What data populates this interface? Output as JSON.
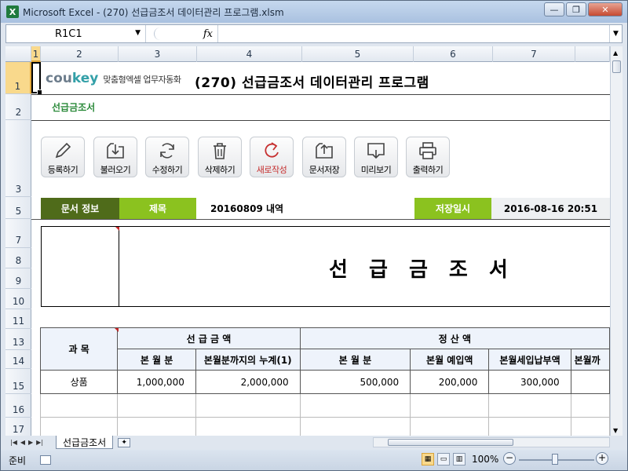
{
  "window": {
    "title": "Microsoft Excel - (270) 선급금조서 데이터관리 프로그램.xlsm",
    "app_icon": "X",
    "buttons": {
      "minimize": "—",
      "restore": "❐",
      "close": "✕"
    }
  },
  "formula_bar": {
    "name_box": "R1C1",
    "fx": "fx",
    "formula": ""
  },
  "columns": [
    "1",
    "2",
    "3",
    "4",
    "5",
    "6",
    "7"
  ],
  "rows": [
    "1",
    "2",
    "3",
    "5",
    "7",
    "8",
    "9",
    "10",
    "11",
    "13",
    "14",
    "15",
    "16",
    "17"
  ],
  "header": {
    "logo_primary": "cou",
    "logo_secondary": "key",
    "logo_tagline": "맞춤형엑셀 업무자동화",
    "title": "(270) 선급금조서 데이터관리 프로그램",
    "subtitle": "선급금조서"
  },
  "toolbar": [
    {
      "id": "register",
      "label": "등록하기",
      "icon": "pencil-icon"
    },
    {
      "id": "load",
      "label": "불러오기",
      "icon": "download-icon"
    },
    {
      "id": "edit",
      "label": "수정하기",
      "icon": "refresh-icon"
    },
    {
      "id": "delete",
      "label": "삭제하기",
      "icon": "trash-icon"
    },
    {
      "id": "new",
      "label": "새로작성",
      "icon": "new-icon"
    },
    {
      "id": "save",
      "label": "문서저장",
      "icon": "upload-icon"
    },
    {
      "id": "preview",
      "label": "미리보기",
      "icon": "monitor-icon"
    },
    {
      "id": "print",
      "label": "출력하기",
      "icon": "printer-icon"
    }
  ],
  "info": {
    "section_label": "문서 정보",
    "title_label": "제목",
    "title_value": "20160809 내역",
    "date_label": "저장일시",
    "date_value": "2016-08-16 20:51"
  },
  "document": {
    "title": "선 급 금 조 서"
  },
  "table": {
    "subject": "과  목",
    "group_prepaid": "선 급 금 액",
    "group_settle": "정     산     액",
    "sub_headers": [
      "본 월 분",
      "본월분까지의 누계(1)",
      "본 월 분",
      "본월 예입액",
      "본월세입납부액",
      "본월까"
    ],
    "rows": [
      [
        "상품",
        "1,000,000",
        "2,000,000",
        "500,000",
        "200,000",
        "300,000",
        ""
      ]
    ]
  },
  "sheet_tab": "선급금조서",
  "status": {
    "ready": "준비",
    "zoom": "100%"
  }
}
